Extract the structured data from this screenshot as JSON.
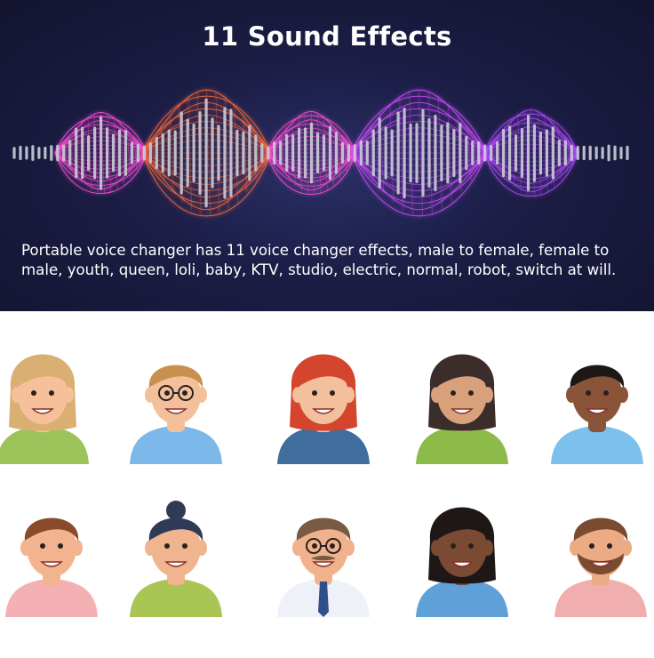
{
  "banner": {
    "title": "11 Sound Effects",
    "description": "Portable voice changer has 11 voice changer effects, male to female, female to male, youth, queen, loli, baby, KTV, studio, electric, normal, robot, switch at will."
  },
  "wave_colors": [
    "#ff4fd8",
    "#ff6a3d",
    "#d04cff",
    "#b24cff"
  ],
  "avatars": [
    {
      "name": "avatar-blonde-woman",
      "hair": "#d9b072",
      "skin": "#f6c19a",
      "shirt": "#9cc35a"
    },
    {
      "name": "avatar-man-glasses",
      "hair": "#c98f4e",
      "skin": "#f4c09b",
      "shirt": "#7cb8ea"
    },
    {
      "name": "avatar-redhead-woman",
      "hair": "#d4452d",
      "skin": "#f3c09d",
      "shirt": "#3f6e9e"
    },
    {
      "name": "avatar-dark-hair-woman",
      "hair": "#3a2d2a",
      "skin": "#d9a07c",
      "shirt": "#8dbb4a"
    },
    {
      "name": "avatar-dark-skin-man",
      "hair": "#1d1716",
      "skin": "#8a5438",
      "shirt": "#7cc0ee"
    },
    {
      "name": "avatar-curly-man",
      "hair": "#8a4b2b",
      "skin": "#f1b48f",
      "shirt": "#f4b0b2"
    },
    {
      "name": "avatar-bun-woman",
      "hair": "#2f3a57",
      "skin": "#f0b48e",
      "shirt": "#a9c654"
    },
    {
      "name": "avatar-mustache-man",
      "hair": "#7b5a45",
      "skin": "#f0b28c",
      "shirt": "#eef2f8"
    },
    {
      "name": "avatar-long-hair-woman",
      "hair": "#1f1716",
      "skin": "#7a4a33",
      "shirt": "#5ea0d7"
    },
    {
      "name": "avatar-bearded-man",
      "hair": "#7a4b30",
      "skin": "#ebab85",
      "shirt": "#f1aeae"
    }
  ]
}
